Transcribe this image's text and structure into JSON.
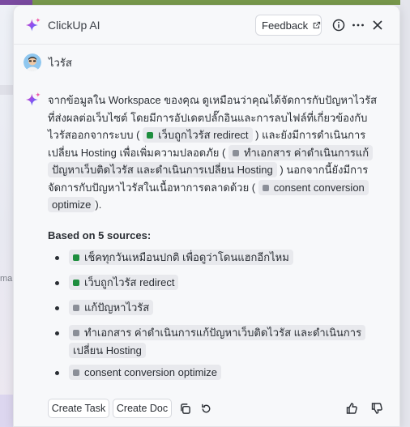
{
  "app": {
    "title": "ClickUp AI"
  },
  "header": {
    "feedback_label": "Feedback"
  },
  "user": {
    "name": "ไวรัส"
  },
  "answer": {
    "seg1": "จากข้อมูลใน Workspace ของคุณ ดูเหมือนว่าคุณได้จัดการกับปัญหาไวรัสที่ส่งผลต่อเว็บไซต์ โดยมีการอัปเดตปลั๊กอินและการลบไฟล์ที่เกี่ยวข้องกับไวรัสออกจากระบบ (",
    "chip1": "เว็บถูกไวรัส redirect",
    "seg2": ") และยังมีการดำเนินการเปลี่ยน Hosting เพื่อเพิ่มความปลอดภัย (",
    "chip2": "ทำเอกสาร ค่าดำเนินการแก้ปัญหาเว็บติดไวรัส และดำเนินการเปลี่ยน Hosting",
    "seg3": ") นอกจากนี้ยังมีการจัดการกับปัญหาไวรัสในเนื้อหาการตลาดด้วย (",
    "chip3": "consent conversion optimize",
    "seg4": ")."
  },
  "sources": {
    "title": "Based on 5 sources:",
    "items": [
      {
        "label": "เช็คทุกวันเหมือนปกติ เพื่อดูว่าโดนแฮกอีกไหม",
        "status_color": "#1e8e3e"
      },
      {
        "label": "เว็บถูกไวรัส redirect",
        "status_color": "#1e8e3e"
      },
      {
        "label": "แก้ปัญหาไวรัส",
        "status_color": "#8b8f98"
      },
      {
        "label": "ทำเอกสาร ค่าดำเนินการแก้ปัญหาเว็บติดไวรัส และดำเนินการเปลี่ยน Hosting",
        "status_color": "#8b8f98"
      },
      {
        "label": "consent conversion optimize",
        "status_color": "#8b8f98"
      }
    ]
  },
  "footer": {
    "create_task": "Create Task",
    "create_doc": "Create Doc"
  },
  "background": {
    "side_text": "ma"
  },
  "icons": [
    "sparkle-icon",
    "external-link-icon",
    "info-icon",
    "more-icon",
    "close-icon",
    "copy-icon",
    "refresh-icon",
    "thumbs-up-icon",
    "thumbs-down-icon"
  ]
}
